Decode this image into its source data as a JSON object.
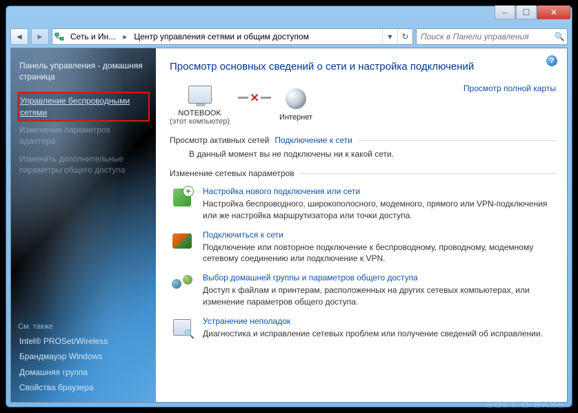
{
  "titlebar": {
    "minimize": "–",
    "maximize": "☐",
    "close": "✕"
  },
  "address": {
    "seg1": "Сеть и Ин...",
    "seg2": "Центр управления сетями и общим доступом"
  },
  "search": {
    "placeholder": "Поиск в Панели управления"
  },
  "sidebar": {
    "home": "Панель управления - домашняя страница",
    "links": [
      "Управление беспроводными сетями",
      "Изменение параметров адаптера",
      "Изменить дополнительные параметры общего доступа"
    ],
    "see_also_title": "См. также",
    "see_also": [
      "Intel® PROSet/Wireless",
      "Брандмауэр Windows",
      "Домашняя группа",
      "Свойства браузера"
    ]
  },
  "main": {
    "title": "Просмотр основных сведений о сети и настройка подключений",
    "map_link": "Просмотр полной карты",
    "node1": {
      "label": "NOTEBOOK",
      "sub": "(этот компьютер)"
    },
    "node2": {
      "label": "Интернет"
    },
    "active_hd": "Просмотр активных сетей",
    "active_link": "Подключение к сети",
    "active_msg": "В данный момент вы не подключены ни к какой сети.",
    "settings_hd": "Изменение сетевых параметров",
    "rows": [
      {
        "title": "Настройка нового подключения или сети",
        "desc": "Настройка беспроводного, широкополосного, модемного, прямого или VPN-подключения или же настройка маршрутизатора или точки доступа."
      },
      {
        "title": "Подключиться к сети",
        "desc": "Подключение или повторное подключение к беспроводному, проводному, модемному сетевому соединению или подключение к VPN."
      },
      {
        "title": "Выбор домашней группы и параметров общего доступа",
        "desc": "Доступ к файлам и принтерам, расположенных на других сетевых компьютерах, или изменение параметров общего доступа."
      },
      {
        "title": "Устранение неполадок",
        "desc": "Диагностика и исправление сетевых проблем или получение сведений об исправлении."
      }
    ]
  },
  "watermark": "SOFT O BASE"
}
